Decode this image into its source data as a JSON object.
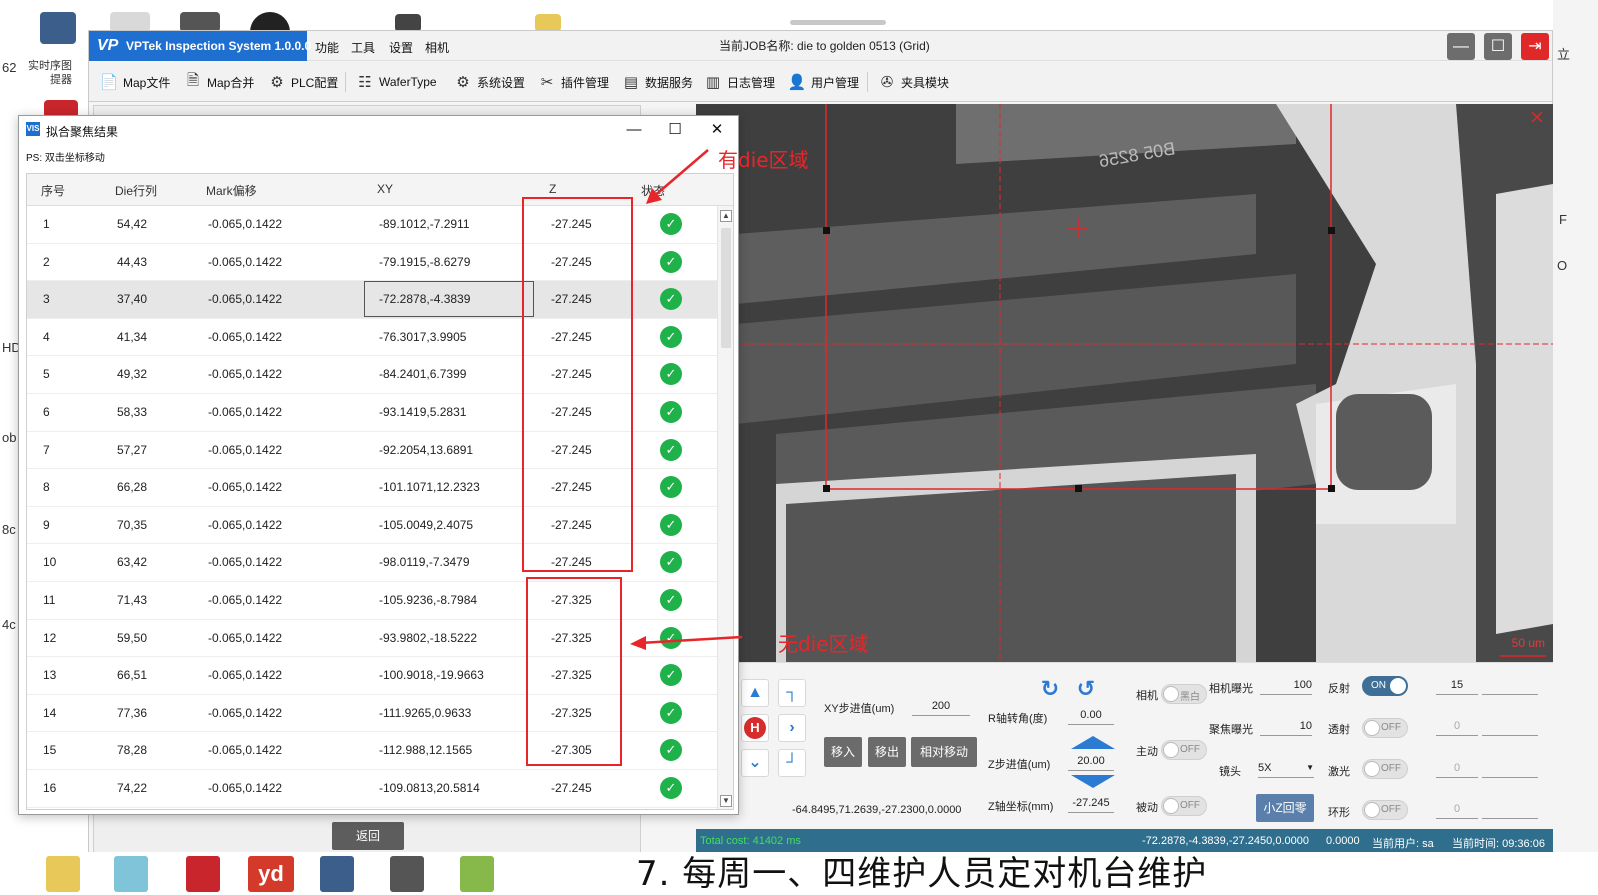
{
  "desktop": {
    "left_labels": [
      "实时序图",
      "提器"
    ],
    "edge_left": [
      "62",
      "HD",
      "ob",
      "8c",
      "4c"
    ],
    "edge_right": [
      "立",
      "F",
      "O"
    ]
  },
  "taskbar": {
    "text": "7. 每周一、四维护人员定对机台维护",
    "yd_label": "yd"
  },
  "app": {
    "logo": "VP",
    "name": "VPTek Inspection System 1.0.0.0",
    "menu": [
      "功能",
      "工具",
      "设置",
      "相机"
    ],
    "job_label": "当前JOB名称:  die to golden 0513 (Grid)",
    "window_controls": {
      "minimize": "—",
      "restore": "☐",
      "exit": "⇥"
    },
    "toolbar": [
      {
        "label": "Map文件",
        "icon": "map-file-icon",
        "glyph": "📄"
      },
      {
        "label": "Map合并",
        "icon": "map-merge-icon",
        "glyph": "🗎"
      },
      {
        "label": "PLC配置",
        "icon": "plc-config-icon",
        "glyph": "⚙"
      },
      {
        "label": "WaferType",
        "icon": "wafer-type-icon",
        "glyph": "☷"
      },
      {
        "label": "系统设置",
        "icon": "system-settings-icon",
        "glyph": "⚙"
      },
      {
        "label": "插件管理",
        "icon": "plugin-manager-icon",
        "glyph": "✂"
      },
      {
        "label": "数据服务",
        "icon": "data-service-icon",
        "glyph": "▤"
      },
      {
        "label": "日志管理",
        "icon": "log-manager-icon",
        "glyph": "▥"
      },
      {
        "label": "用户管理",
        "icon": "user-manager-icon",
        "glyph": "👤"
      },
      {
        "label": "夹具模块",
        "icon": "fixture-module-icon",
        "glyph": "✇"
      }
    ]
  },
  "camera": {
    "scale_bar": "50 um",
    "mirrored_text": "B05 8256"
  },
  "controls": {
    "xy_step_label": "XY步进值(um)",
    "xy_step_value": "200",
    "r_angle_label": "R轴转角(度)",
    "r_angle_value": "0.00",
    "z_step_label": "Z步进值(um)",
    "z_step_value": "20.00",
    "z_coord_label": "Z轴坐标(mm)",
    "z_coord_value": "-27.245",
    "move_in": "移入",
    "move_out": "移出",
    "relative_move": "相对移动",
    "coordinates": "-64.8495,71.2639,-27.2300,0.0000",
    "home_label": "H",
    "camera_label": "相机",
    "camera_toggle": "黑白",
    "active_label": "主动",
    "passive_label": "被动",
    "off": "OFF",
    "on": "ON",
    "zero_button": "小Z回零",
    "exposure_label": "相机曝光",
    "exposure_value": "100",
    "focus_exposure_label": "聚焦曝光",
    "focus_exposure_value": "10",
    "lens_label": "镜头",
    "lens_value": "5X",
    "reflect_label": "反射",
    "reflect_value": "15",
    "transmit_label": "透射",
    "transmit_value": "0",
    "laser_label": "激光",
    "laser_value": "0",
    "ring_label": "环形",
    "ring_value": "0"
  },
  "status": {
    "total_cost": "Total cost: 41402 ms",
    "position": "-72.2878,-4.3839,-27.2450,0.0000",
    "extra": "0.0000",
    "user": "当前用户: sa",
    "time": "当前时间: 09:36:06"
  },
  "under_panel": {
    "back_button": "返回"
  },
  "dialog": {
    "app_icon": "VIS",
    "title": "拟合聚焦结果",
    "controls": {
      "minimize": "—",
      "maximize": "☐",
      "close": "✕"
    },
    "note": "PS: 双击坐标移动",
    "columns": [
      "序号",
      "Die行列",
      "Mark偏移",
      "XY",
      "Z",
      "状态"
    ],
    "rows": [
      {
        "no": "1",
        "die": "54,42",
        "mark": "-0.065,0.1422",
        "xy": "-89.1012,-7.2911",
        "z": "-27.245"
      },
      {
        "no": "2",
        "die": "44,43",
        "mark": "-0.065,0.1422",
        "xy": "-79.1915,-8.6279",
        "z": "-27.245"
      },
      {
        "no": "3",
        "die": "37,40",
        "mark": "-0.065,0.1422",
        "xy": "-72.2878,-4.3839",
        "z": "-27.245"
      },
      {
        "no": "4",
        "die": "41,34",
        "mark": "-0.065,0.1422",
        "xy": "-76.3017,3.9905",
        "z": "-27.245"
      },
      {
        "no": "5",
        "die": "49,32",
        "mark": "-0.065,0.1422",
        "xy": "-84.2401,6.7399",
        "z": "-27.245"
      },
      {
        "no": "6",
        "die": "58,33",
        "mark": "-0.065,0.1422",
        "xy": "-93.1419,5.2831",
        "z": "-27.245"
      },
      {
        "no": "7",
        "die": "57,27",
        "mark": "-0.065,0.1422",
        "xy": "-92.2054,13.6891",
        "z": "-27.245"
      },
      {
        "no": "8",
        "die": "66,28",
        "mark": "-0.065,0.1422",
        "xy": "-101.1071,12.2323",
        "z": "-27.245"
      },
      {
        "no": "9",
        "die": "70,35",
        "mark": "-0.065,0.1422",
        "xy": "-105.0049,2.4075",
        "z": "-27.245"
      },
      {
        "no": "10",
        "die": "63,42",
        "mark": "-0.065,0.1422",
        "xy": "-98.0119,-7.3479",
        "z": "-27.245"
      },
      {
        "no": "11",
        "die": "71,43",
        "mark": "-0.065,0.1422",
        "xy": "-105.9236,-8.7984",
        "z": "-27.325"
      },
      {
        "no": "12",
        "die": "59,50",
        "mark": "-0.065,0.1422",
        "xy": "-93.9802,-18.5222",
        "z": "-27.325"
      },
      {
        "no": "13",
        "die": "66,51",
        "mark": "-0.065,0.1422",
        "xy": "-100.9018,-19.9663",
        "z": "-27.325"
      },
      {
        "no": "14",
        "die": "77,36",
        "mark": "-0.065,0.1422",
        "xy": "-111.9265,0.9633",
        "z": "-27.325"
      },
      {
        "no": "15",
        "die": "78,28",
        "mark": "-0.065,0.1422",
        "xy": "-112.988,12.1565",
        "z": "-27.305"
      },
      {
        "no": "16",
        "die": "74,22",
        "mark": "-0.065,0.1422",
        "xy": "-109.0813,20.5814",
        "z": "-27.245"
      }
    ],
    "status_glyph": "✓",
    "scroll_up": "▲",
    "scroll_down": "▼"
  },
  "annotations": {
    "has_die": "有die区域",
    "no_die": "无die区域",
    "color": "#e8262a"
  }
}
